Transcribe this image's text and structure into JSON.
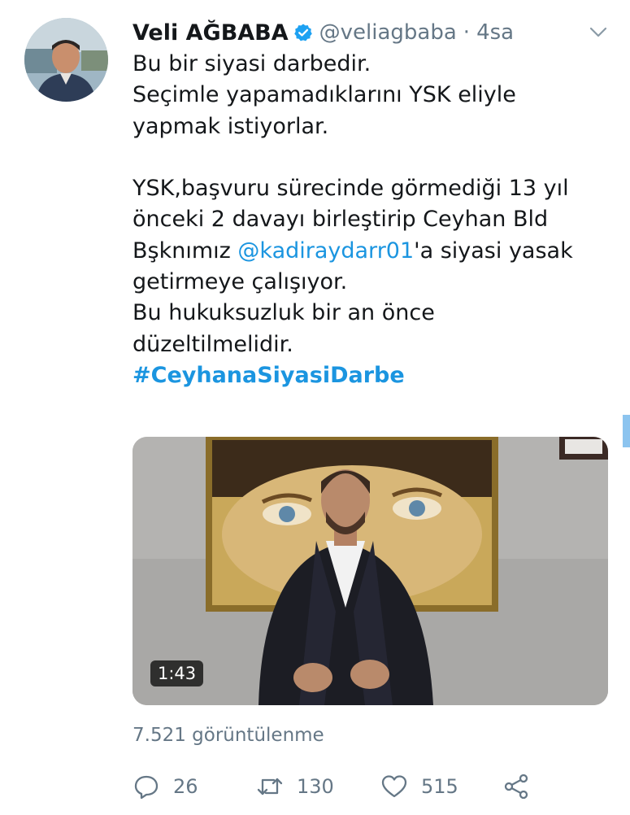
{
  "author": {
    "name": "Veli AĞBABA",
    "handle": "@veliagbaba",
    "separator": "·",
    "time": "4sa",
    "verified": true
  },
  "tweet": {
    "lines": [
      "Bu bir siyasi darbedir.",
      "Seçimle yapamadıklarını YSK eliyle",
      "yapmak istiyorlar.",
      "",
      "YSK,başvuru sürecinde görmediği 13 yıl",
      "önceki 2 davayı birleştirip Ceyhan Bld",
      "Bşknımız ",
      "getirmeye çalışıyor.",
      "Bu hukuksuzluk bir an önce",
      "düzeltilmelidir."
    ],
    "mention": "@kadiraydarr01",
    "mention_suffix": "'a siyasi yasak",
    "hashtag": "#CeyhanaSiyasiDarbe"
  },
  "video": {
    "duration": "1:43"
  },
  "views": "7.521 görüntülenme",
  "actions": {
    "reply_count": "26",
    "retweet_count": "130",
    "like_count": "515"
  },
  "colors": {
    "link": "#1b95e0",
    "muted": "#657786",
    "text": "#14171a",
    "verified": "#1da1f2"
  }
}
